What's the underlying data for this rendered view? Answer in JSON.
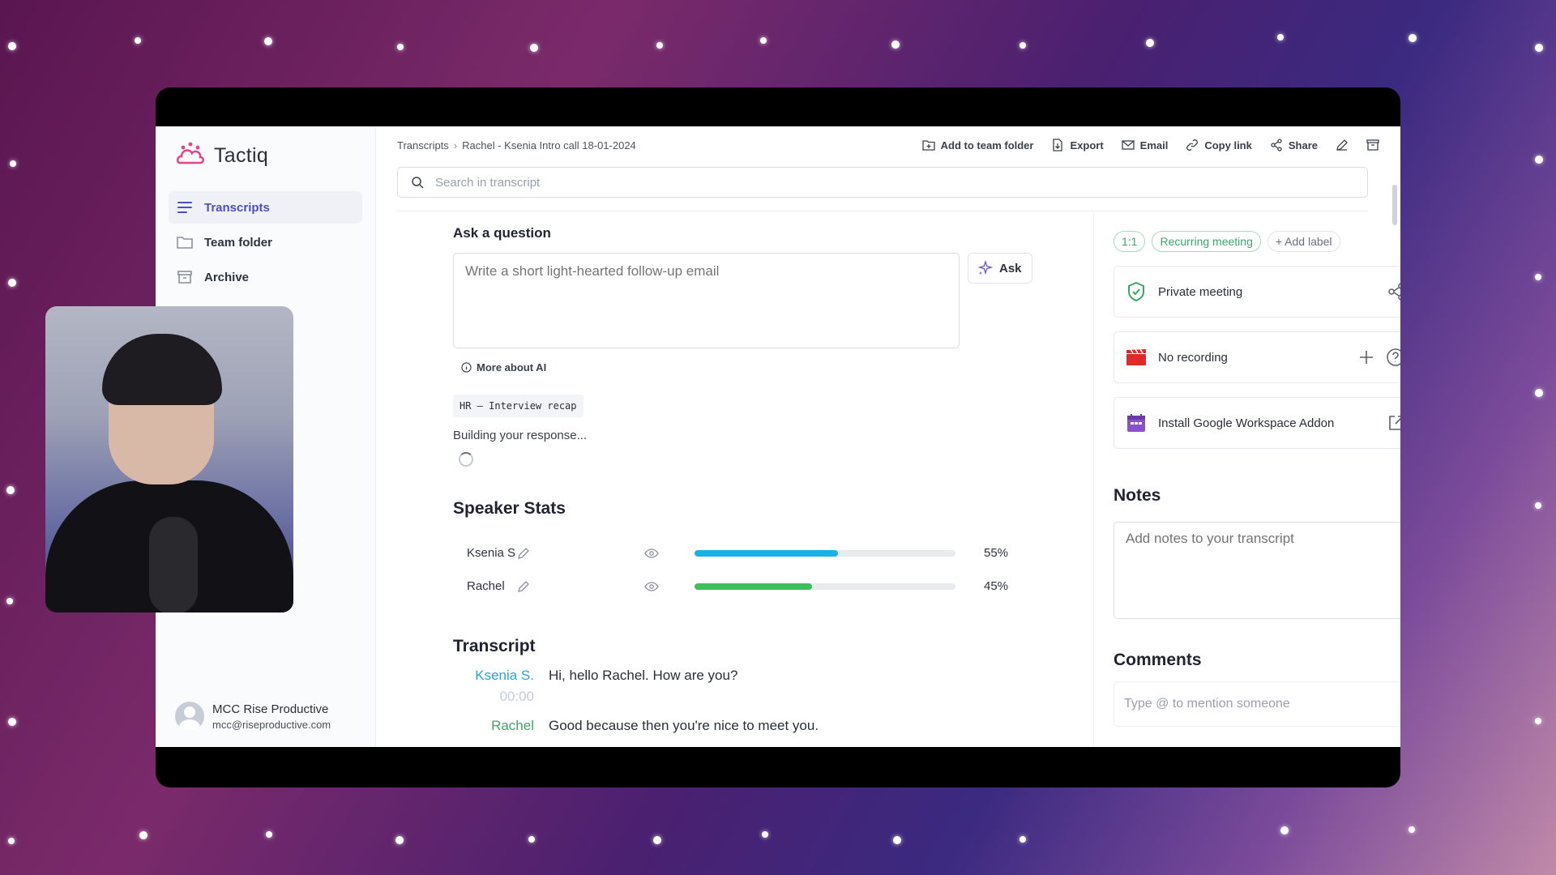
{
  "app": {
    "name": "Tactiq",
    "brand_color": "#4b4fc4"
  },
  "sidebar": {
    "items": [
      {
        "label": "Transcripts",
        "icon": "list-icon",
        "active": true
      },
      {
        "label": "Team folder",
        "icon": "folder-icon",
        "active": false
      },
      {
        "label": "Archive",
        "icon": "archive-icon",
        "active": false
      }
    ],
    "account": {
      "name": "MCC Rise Productive",
      "email": "mcc@riseproductive.com"
    }
  },
  "header": {
    "breadcrumb": [
      "Transcripts",
      "Rachel - Ksenia Intro call 18-01-2024"
    ],
    "actions": {
      "add_to_team_folder": "Add to team folder",
      "export": "Export",
      "email": "Email",
      "copy_link": "Copy link",
      "share": "Share"
    },
    "search_placeholder": "Search in transcript"
  },
  "ask": {
    "title": "Ask a question",
    "placeholder": "Write a short light-hearted follow-up email",
    "button": "Ask",
    "more_about_ai": "More about AI",
    "prompt_chip": "HR – Interview recap",
    "status": "Building your response..."
  },
  "speaker_stats": {
    "title": "Speaker Stats",
    "speakers": [
      {
        "name": "Ksenia S",
        "percent": "55%",
        "share": 0.55,
        "color": "#1ab0e8"
      },
      {
        "name": "Rachel",
        "percent": "45%",
        "share": 0.45,
        "color": "#3cc05c"
      }
    ]
  },
  "transcript": {
    "title": "Transcript",
    "lines": [
      {
        "speaker": "Ksenia S.",
        "time": "00:00",
        "text": "Hi, hello Rachel. How are you?",
        "color": "#2fa3d8"
      },
      {
        "speaker": "Rachel",
        "time": "",
        "text": "Good because then you're nice to meet you.",
        "color": "#3fa66a"
      }
    ]
  },
  "right_panel": {
    "labels": [
      "1:1",
      "Recurring meeting",
      "+ Add label"
    ],
    "cards": [
      {
        "label": "Private meeting",
        "icon": "shield-check-icon"
      },
      {
        "label": "No recording",
        "icon": "clapperboard-icon"
      },
      {
        "label": "Install Google Workspace Addon",
        "icon": "calendar-icon"
      }
    ],
    "notes_title": "Notes",
    "notes_placeholder": "Add notes to your transcript",
    "comments_title": "Comments",
    "comments_placeholder": "Type @ to mention someone"
  }
}
